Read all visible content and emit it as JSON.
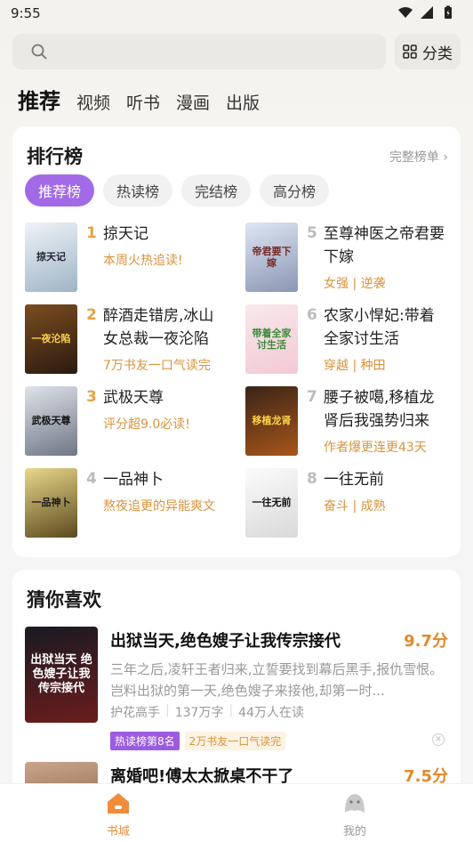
{
  "status": {
    "time": "9:55"
  },
  "search": {
    "placeholder": ""
  },
  "category_button": "分类",
  "tabs": [
    "推荐",
    "视频",
    "听书",
    "漫画",
    "出版"
  ],
  "ranking": {
    "title": "排行榜",
    "more": "完整榜单",
    "chips": [
      "推荐榜",
      "热读榜",
      "完结榜",
      "高分榜"
    ],
    "items": [
      {
        "rank": "1",
        "title": "掠天记",
        "tag": "本周火热追读!",
        "cover_text": "掠天记"
      },
      {
        "rank": "5",
        "title": "至尊神医之帝君要下嫁",
        "tag": "女强 | 逆袭",
        "cover_text": "帝君要下嫁"
      },
      {
        "rank": "2",
        "title": "醉酒走错房,冰山女总裁一夜沦陷",
        "tag": "7万书友一口气读完",
        "cover_text": "一夜沦陷"
      },
      {
        "rank": "6",
        "title": "农家小悍妃:带着全家讨生活",
        "tag": "穿越 | 种田",
        "cover_text": "带着全家讨生活"
      },
      {
        "rank": "3",
        "title": "武极天尊",
        "tag": "评分超9.0必读!",
        "cover_text": "武极天尊"
      },
      {
        "rank": "7",
        "title": "腰子被噶,移植龙肾后我强势归来",
        "tag": "作者爆更连更43天",
        "cover_text": "移植龙肾"
      },
      {
        "rank": "4",
        "title": "一品神卜",
        "tag": "熬夜追更的异能爽文",
        "cover_text": "一品神卜"
      },
      {
        "rank": "8",
        "title": "一往无前",
        "tag": "奋斗 | 成熟",
        "cover_text": "一往无前"
      }
    ]
  },
  "guess": {
    "title": "猜你喜欢",
    "books": [
      {
        "title": "出狱当天,绝色嫂子让我传宗接代",
        "score": "9.7分",
        "desc": "三年之后,凌轩王者归来,立誓要找到幕后黑手,报仇雪恨。岂料出狱的第一天,绝色嫂子来接他,却第一时...",
        "author": "护花高手",
        "words": "137万字",
        "readers": "44万人在读",
        "badge1": "热读榜第8名",
        "badge2": "2万书友一口气读完",
        "cover_text": "出狱当天 绝色嫂子让我传宗接代"
      },
      {
        "title": "离婚吧!傅太太掀桌不干了",
        "score": "7.5分",
        "cover_text": ""
      }
    ]
  },
  "nav": {
    "home": "书城",
    "me": "我的"
  },
  "colors": {
    "accent": "#a26ae6",
    "orange": "#e2892a",
    "tag": "#d9933b"
  }
}
